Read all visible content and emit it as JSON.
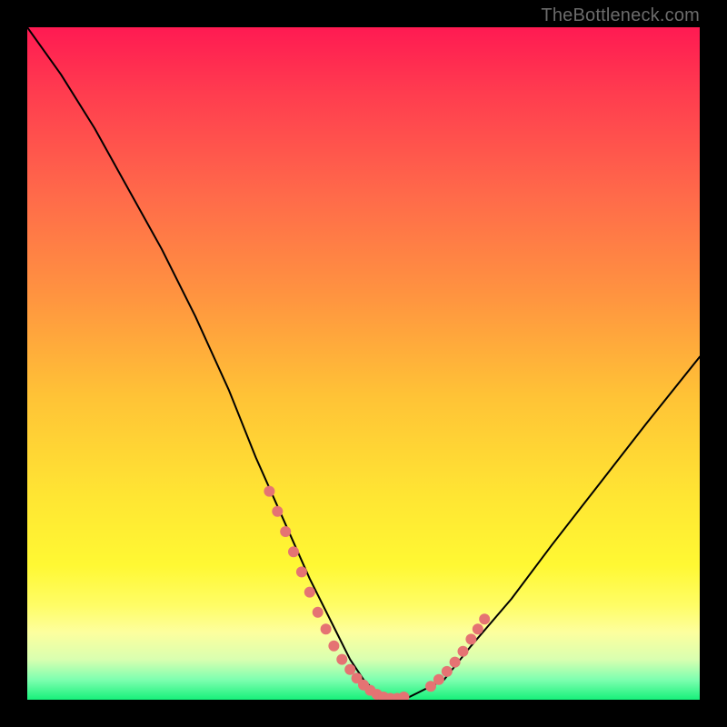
{
  "attribution": "TheBottleneck.com",
  "chart_data": {
    "type": "line",
    "title": "",
    "xlabel": "",
    "ylabel": "",
    "xlim": [
      0,
      100
    ],
    "ylim": [
      0,
      100
    ],
    "grid": false,
    "legend": false,
    "series": [
      {
        "name": "bottleneck-curve",
        "x": [
          0,
          5,
          10,
          15,
          20,
          25,
          30,
          34,
          38,
          42,
          46,
          48,
          50,
          52,
          54,
          56,
          58,
          62,
          66,
          72,
          78,
          85,
          92,
          100
        ],
        "y": [
          100,
          93,
          85,
          76,
          67,
          57,
          46,
          36,
          27,
          18,
          10,
          6,
          3,
          1,
          0,
          0,
          1,
          3,
          8,
          15,
          23,
          32,
          41,
          51
        ]
      }
    ],
    "markers": [
      {
        "name": "left-lobe-dots",
        "x": [
          36,
          37.2,
          38.4,
          39.6,
          40.8,
          42,
          43.2,
          44.4,
          45.6,
          46.8,
          48,
          49,
          50,
          51,
          52,
          53,
          54,
          55,
          56
        ],
        "y": [
          31,
          28,
          25,
          22,
          19,
          16,
          13,
          10.5,
          8,
          6,
          4.5,
          3.2,
          2.2,
          1.4,
          0.8,
          0.4,
          0.2,
          0.2,
          0.4
        ],
        "color": "#e57373",
        "radius": 6
      },
      {
        "name": "right-lobe-dots",
        "x": [
          60,
          61.2,
          62.4,
          63.6,
          64.8,
          66,
          67,
          68
        ],
        "y": [
          2,
          3,
          4.2,
          5.6,
          7.2,
          9,
          10.5,
          12
        ],
        "color": "#e57373",
        "radius": 6
      }
    ]
  }
}
